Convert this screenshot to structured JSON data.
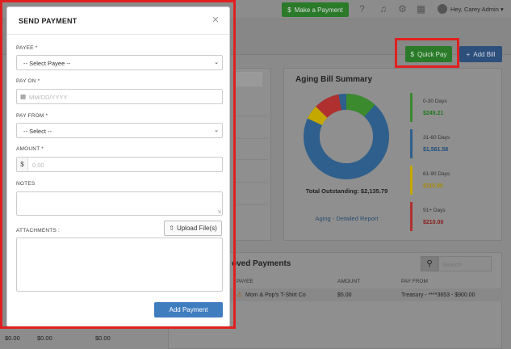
{
  "topbar": {
    "make_payment_label": "Make a Payment",
    "user_name": "Hey, Carey Admin"
  },
  "actions": {
    "quick_pay_label": "Quick Pay",
    "add_bill_label": "Add Bill"
  },
  "aging": {
    "title": "Aging Bill Summary",
    "total_label": "Total Outstanding: $2,135.79",
    "link_label": "Aging - Detailed Report",
    "buckets": [
      {
        "label": "0-30 Days",
        "amount": "$249.21",
        "color": "#1f7a1f"
      },
      {
        "label": "31-60 Days",
        "amount": "$1,561.58",
        "color": "#1f4e7c"
      },
      {
        "label": "61-90 Days",
        "amount": "$115.00",
        "color": "#a88a00"
      },
      {
        "label": "91+ Days",
        "amount": "$210.00",
        "color": "#8b1a1a"
      }
    ]
  },
  "approved": {
    "title": "oved Payments",
    "search_placeholder": "Search",
    "columns": [
      "PAYEE",
      "AMOUNT",
      "PAY FROM"
    ],
    "rows": [
      {
        "payee": "Mom & Pop's T-Shirt Co",
        "amount": "$5.00",
        "pay_from": "Treasury - ****3653 - $900.00"
      }
    ]
  },
  "bottom_left": {
    "values": [
      "$0.00",
      "$0.00",
      "$0.00"
    ]
  },
  "modal": {
    "title": "SEND PAYMENT",
    "close_glyph": "×",
    "payee_label": "PAYEE *",
    "payee_value": "-- Select Payee --",
    "pay_on_label": "PAY ON *",
    "pay_on_placeholder": "MM/DD/YYYY",
    "pay_from_label": "PAY FROM *",
    "pay_from_value": "-- Select --",
    "amount_label": "AMOUNT *",
    "amount_currency": "$",
    "amount_placeholder": "0.00",
    "notes_label": "NOTES",
    "upload_label": "Upload File(s)",
    "attachments_label": "ATTACHMENTS :",
    "submit_label": "Add Payment"
  }
}
